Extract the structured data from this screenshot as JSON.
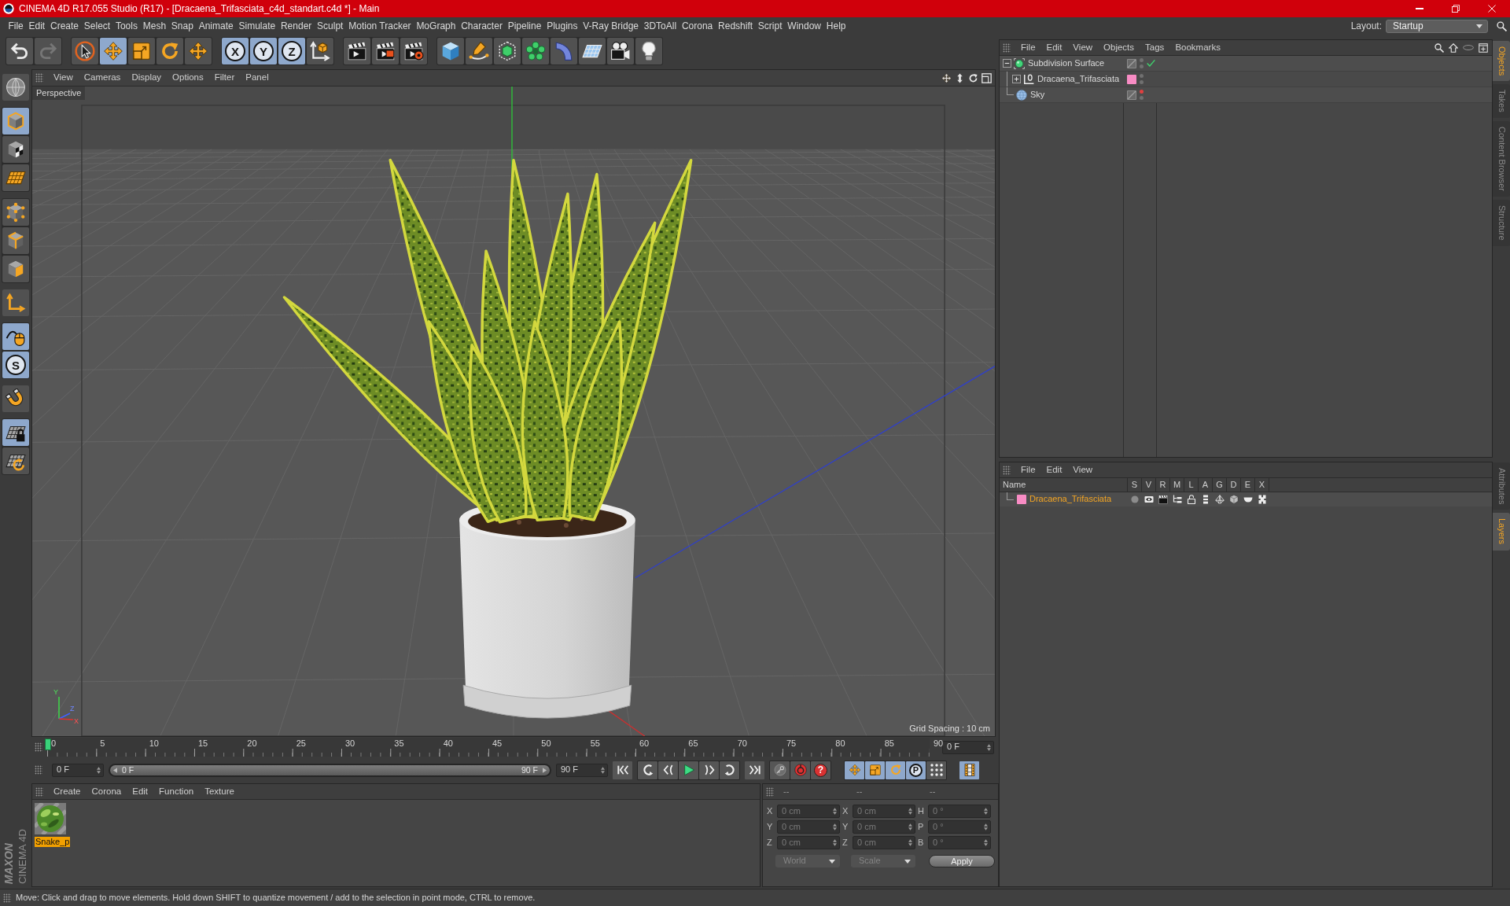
{
  "window": {
    "title": "CINEMA 4D R17.055 Studio (R17) - [Dracaena_Trifasciata_c4d_standart.c4d *] - Main"
  },
  "menu_bar": {
    "items": [
      "File",
      "Edit",
      "Create",
      "Select",
      "Tools",
      "Mesh",
      "Snap",
      "Animate",
      "Simulate",
      "Render",
      "Sculpt",
      "Motion Tracker",
      "MoGraph",
      "Character",
      "Pipeline",
      "Plugins",
      "V-Ray Bridge",
      "3DToAll",
      "Corona",
      "Redshift",
      "Script",
      "Window",
      "Help"
    ],
    "layout_label": "Layout:",
    "layout_value": "Startup"
  },
  "toolbar": [
    {
      "tools": [
        {
          "kind": "undo",
          "on": false,
          "disabled": false
        },
        {
          "kind": "redo",
          "on": false,
          "disabled": true
        }
      ]
    },
    {
      "tools": [
        {
          "kind": "select",
          "on": false
        },
        {
          "kind": "move",
          "on": true
        },
        {
          "kind": "scale",
          "on": false
        },
        {
          "kind": "rotate",
          "on": false
        },
        {
          "kind": "recent",
          "on": false
        }
      ]
    },
    {
      "tools": [
        {
          "kind": "axis",
          "label": "X",
          "on": true
        },
        {
          "kind": "axis",
          "label": "Y",
          "on": true
        },
        {
          "kind": "axis",
          "label": "Z",
          "on": true
        },
        {
          "kind": "coords",
          "on": false
        }
      ]
    },
    {
      "tools": [
        {
          "kind": "render-view",
          "on": false
        },
        {
          "kind": "render-picture",
          "on": false
        },
        {
          "kind": "render-settings",
          "on": false
        }
      ]
    },
    {
      "tools": [
        {
          "kind": "cube",
          "on": false
        },
        {
          "kind": "pen",
          "on": false
        },
        {
          "kind": "subdivision",
          "on": false
        },
        {
          "kind": "cloner",
          "on": false
        },
        {
          "kind": "bend",
          "on": false
        },
        {
          "kind": "floor",
          "on": false
        },
        {
          "kind": "camera",
          "on": false
        },
        {
          "kind": "light",
          "on": false
        }
      ]
    }
  ],
  "tool_palette": [
    {
      "tools": [
        {
          "kind": "editable",
          "on": false
        }
      ]
    },
    {
      "tools": [
        {
          "kind": "model",
          "on": true
        },
        {
          "kind": "texture",
          "on": false
        },
        {
          "kind": "workplane",
          "on": false
        }
      ]
    },
    {
      "tools": [
        {
          "kind": "points",
          "on": false
        },
        {
          "kind": "edges",
          "on": false
        },
        {
          "kind": "polygons",
          "on": false
        }
      ]
    },
    {
      "tools": [
        {
          "kind": "axis-mode",
          "on": false
        }
      ]
    },
    {
      "tools": [
        {
          "kind": "tweak",
          "on": true
        },
        {
          "kind": "snap",
          "label": "S",
          "on": true
        }
      ]
    },
    {
      "tools": [
        {
          "kind": "magnet",
          "on": false
        }
      ]
    },
    {
      "tools": [
        {
          "kind": "grid-lock",
          "on": true
        },
        {
          "kind": "grid-rotate",
          "on": false
        }
      ]
    }
  ],
  "logo": {
    "brand": "MAXON",
    "product": "CINEMA 4D"
  },
  "viewport": {
    "menu": [
      "View",
      "Cameras",
      "Display",
      "Options",
      "Filter",
      "Panel"
    ],
    "camera": "Perspective",
    "grid_spacing": "Grid Spacing : 10 cm",
    "axis_labels": [
      "Y",
      "Z",
      "X"
    ]
  },
  "timeline": {
    "ticks": [
      "0",
      "5",
      "10",
      "15",
      "20",
      "25",
      "30",
      "35",
      "40",
      "45",
      "50",
      "55",
      "60",
      "65",
      "70",
      "75",
      "80",
      "85",
      "90"
    ],
    "level": 0,
    "frame": "0 F"
  },
  "playback": {
    "start": "0 F",
    "range": {
      "start": "0 F",
      "end": "90 F",
      "level": 1
    },
    "end": "90 F",
    "button_groups": [
      {
        "buttons": [
          {
            "kind": "first"
          }
        ]
      },
      {
        "buttons": [
          {
            "kind": "prev-key"
          },
          {
            "kind": "prev-frame"
          },
          {
            "kind": "play"
          },
          {
            "kind": "next-frame"
          },
          {
            "kind": "next-key"
          }
        ]
      },
      {
        "buttons": [
          {
            "kind": "last"
          }
        ]
      },
      {
        "buttons": [
          {
            "kind": "record-key"
          },
          {
            "kind": "autokey"
          },
          {
            "kind": "key-help",
            "label": "?"
          }
        ]
      }
    ],
    "key_types": [
      {
        "kind": "move",
        "on": true
      },
      {
        "kind": "scale",
        "on": true
      },
      {
        "kind": "rotate",
        "on": true
      },
      {
        "kind": "param",
        "label": "P",
        "on": true
      },
      {
        "kind": "point-level",
        "on": false
      }
    ],
    "timeline_button": {
      "on": true
    }
  },
  "material_manager": {
    "menu": [
      "Create",
      "Corona",
      "Edit",
      "Function",
      "Texture"
    ],
    "materials": [
      {
        "name": "Snake_p",
        "selected": true
      }
    ]
  },
  "coordinates": {
    "headers": [
      "--",
      "--",
      "--"
    ],
    "rows": [
      [
        {
          "axis": "X",
          "value": "0 cm"
        },
        {
          "axis": "X",
          "value": "0 cm"
        },
        {
          "axis": "H",
          "value": "0 °"
        }
      ],
      [
        {
          "axis": "Y",
          "value": "0 cm"
        },
        {
          "axis": "Y",
          "value": "0 cm"
        },
        {
          "axis": "P",
          "value": "0 °"
        }
      ],
      [
        {
          "axis": "Z",
          "value": "0 cm"
        },
        {
          "axis": "Z",
          "value": "0 cm"
        },
        {
          "axis": "B",
          "value": "0 °"
        }
      ]
    ],
    "space": "World",
    "mode": "Scale",
    "apply": "Apply",
    "disabled": true
  },
  "object_manager": {
    "menu": [
      "File",
      "Edit",
      "View",
      "Objects",
      "Tags",
      "Bookmarks"
    ],
    "objects": [
      {
        "name": "Subdivision Surface",
        "kind": "subdivision",
        "expanded": true,
        "checked": true,
        "editor_hidden": false,
        "children": [
          {
            "name": "Dracaena_Trifasciata",
            "kind": "null",
            "expanded": false,
            "color": "#f88cc4",
            "checked": false,
            "editor_hidden": false
          }
        ]
      },
      {
        "name": "Sky",
        "kind": "sky",
        "checked": false,
        "editor_hidden": true
      }
    ]
  },
  "layer_manager": {
    "menu": [
      "File",
      "Edit",
      "View"
    ],
    "columns": [
      "Name",
      "S",
      "V",
      "R",
      "M",
      "L",
      "A",
      "G",
      "D",
      "E",
      "X"
    ],
    "layers": [
      {
        "name": "Dracaena_Trifasciata",
        "color": "#f88cc4",
        "selected": true
      }
    ]
  },
  "side_tabs": {
    "top": [
      {
        "label": "Objects",
        "selected": true
      },
      {
        "label": "Takes",
        "selected": false
      },
      {
        "label": "Content Browser",
        "selected": false
      },
      {
        "label": "Structure",
        "selected": false
      }
    ],
    "bottom": [
      {
        "label": "Attributes",
        "selected": false
      },
      {
        "label": "Layers",
        "selected": true
      }
    ]
  },
  "status_bar": {
    "text": "Move: Click and drag to move elements. Hold down SHIFT to quantize movement / add to the selection in point mode, CTRL to remove."
  }
}
